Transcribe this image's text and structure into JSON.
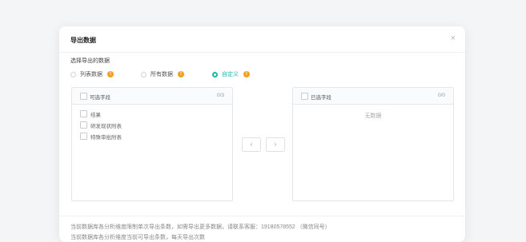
{
  "dialog": {
    "title": "导出数据",
    "close_glyph": "×"
  },
  "select_section": {
    "label": "选择导出的数据",
    "options": [
      {
        "label": "列表数据",
        "checked": false
      },
      {
        "label": "所有数据",
        "checked": false
      },
      {
        "label": "自定义",
        "checked": true
      }
    ],
    "info_glyph": "!"
  },
  "left_panel": {
    "title": "可选字段",
    "count": "0/3",
    "items": [
      "结果",
      "研发现状附表",
      "特殊审批附表"
    ]
  },
  "right_panel": {
    "title": "已选字段",
    "count": "0/0",
    "empty": "无数据"
  },
  "transfer": {
    "left_glyph": "‹",
    "right_glyph": "›"
  },
  "footer": {
    "note1": "当前数据库各分析维度限制单次导出条数，如需导出更多数据，请联系客服：19180578552 （微信同号）",
    "note2": "当前数据库各分析维度当前可导出条数，每天导出次数"
  },
  "colors": {
    "accent": "#1ab7a8",
    "info": "#f0a020"
  }
}
